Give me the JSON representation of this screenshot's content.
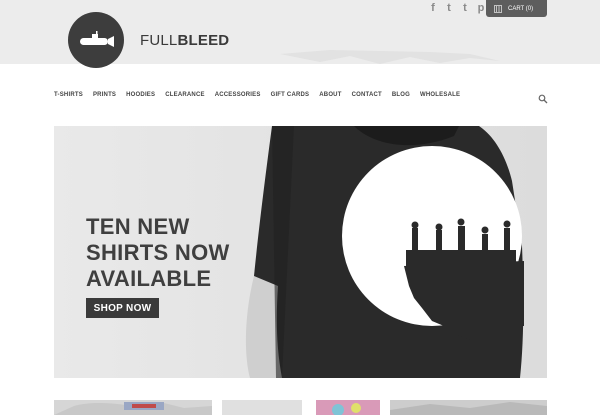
{
  "brand": {
    "light": "FULL",
    "bold": "BLEED"
  },
  "social": [
    "f",
    "t",
    "t",
    "p"
  ],
  "social_names": [
    "facebook-icon",
    "twitter-icon",
    "tumblr-icon",
    "pinterest-icon"
  ],
  "cart": {
    "label": "CART (0)"
  },
  "nav": [
    "T-SHIRTS",
    "PRINTS",
    "HOODIES",
    "CLEARANCE",
    "ACCESSORIES",
    "GIFT CARDS",
    "ABOUT",
    "CONTACT",
    "BLOG",
    "WHOLESALE"
  ],
  "hero": {
    "line1": "TEN NEW",
    "line2": "SHIRTS NOW",
    "line3": "AVAILABLE",
    "cta": "SHOP NOW"
  },
  "colors": {
    "dark": "#3a3a3a",
    "header_bg": "#ececec",
    "hero_bg": "#e6e6e6"
  }
}
